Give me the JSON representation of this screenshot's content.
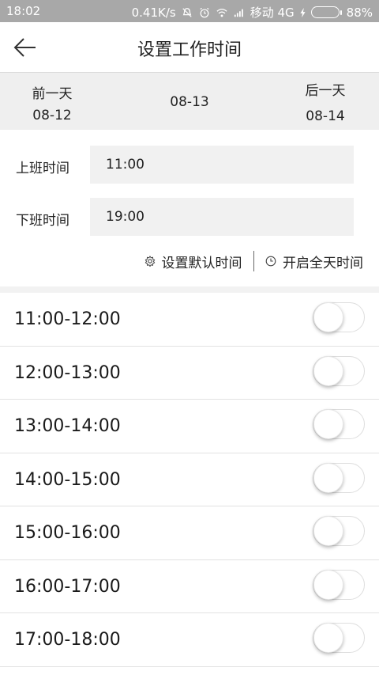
{
  "status_bar": {
    "time": "18:02",
    "network_speed": "0.41K/s",
    "carrier": "移动 4G",
    "battery_percent": "88%",
    "battery_level": 0.88,
    "icons": [
      "mute-icon",
      "alarm-icon",
      "wifi-icon",
      "signal-icon",
      "charging-icon",
      "battery-icon"
    ]
  },
  "header": {
    "title": "设置工作时间",
    "back_icon": "back-arrow-icon"
  },
  "date_nav": {
    "prev_label": "前一天",
    "prev_date": "08-12",
    "current_date": "08-13",
    "next_label": "后一天",
    "next_date": "08-14"
  },
  "work_time": {
    "on_label": "上班时间",
    "on_value": "11:00",
    "off_label": "下班时间",
    "off_value": "19:00"
  },
  "actions": {
    "set_default_label": "设置默认时间",
    "set_default_icon": "gear-icon",
    "all_day_label": "开启全天时间",
    "all_day_icon": "clock-icon"
  },
  "slots": [
    {
      "label": "11:00-12:00",
      "enabled": false
    },
    {
      "label": "12:00-13:00",
      "enabled": false
    },
    {
      "label": "13:00-14:00",
      "enabled": false
    },
    {
      "label": "14:00-15:00",
      "enabled": false
    },
    {
      "label": "15:00-16:00",
      "enabled": false
    },
    {
      "label": "16:00-17:00",
      "enabled": false
    },
    {
      "label": "17:00-18:00",
      "enabled": false
    }
  ],
  "colors": {
    "status_bar_bg": "#a8a8a8",
    "date_bar_bg": "#efefef",
    "input_bg": "#f1f1f1",
    "battery_fill": "#2ecc40",
    "toggle_on": "#4cd964"
  }
}
